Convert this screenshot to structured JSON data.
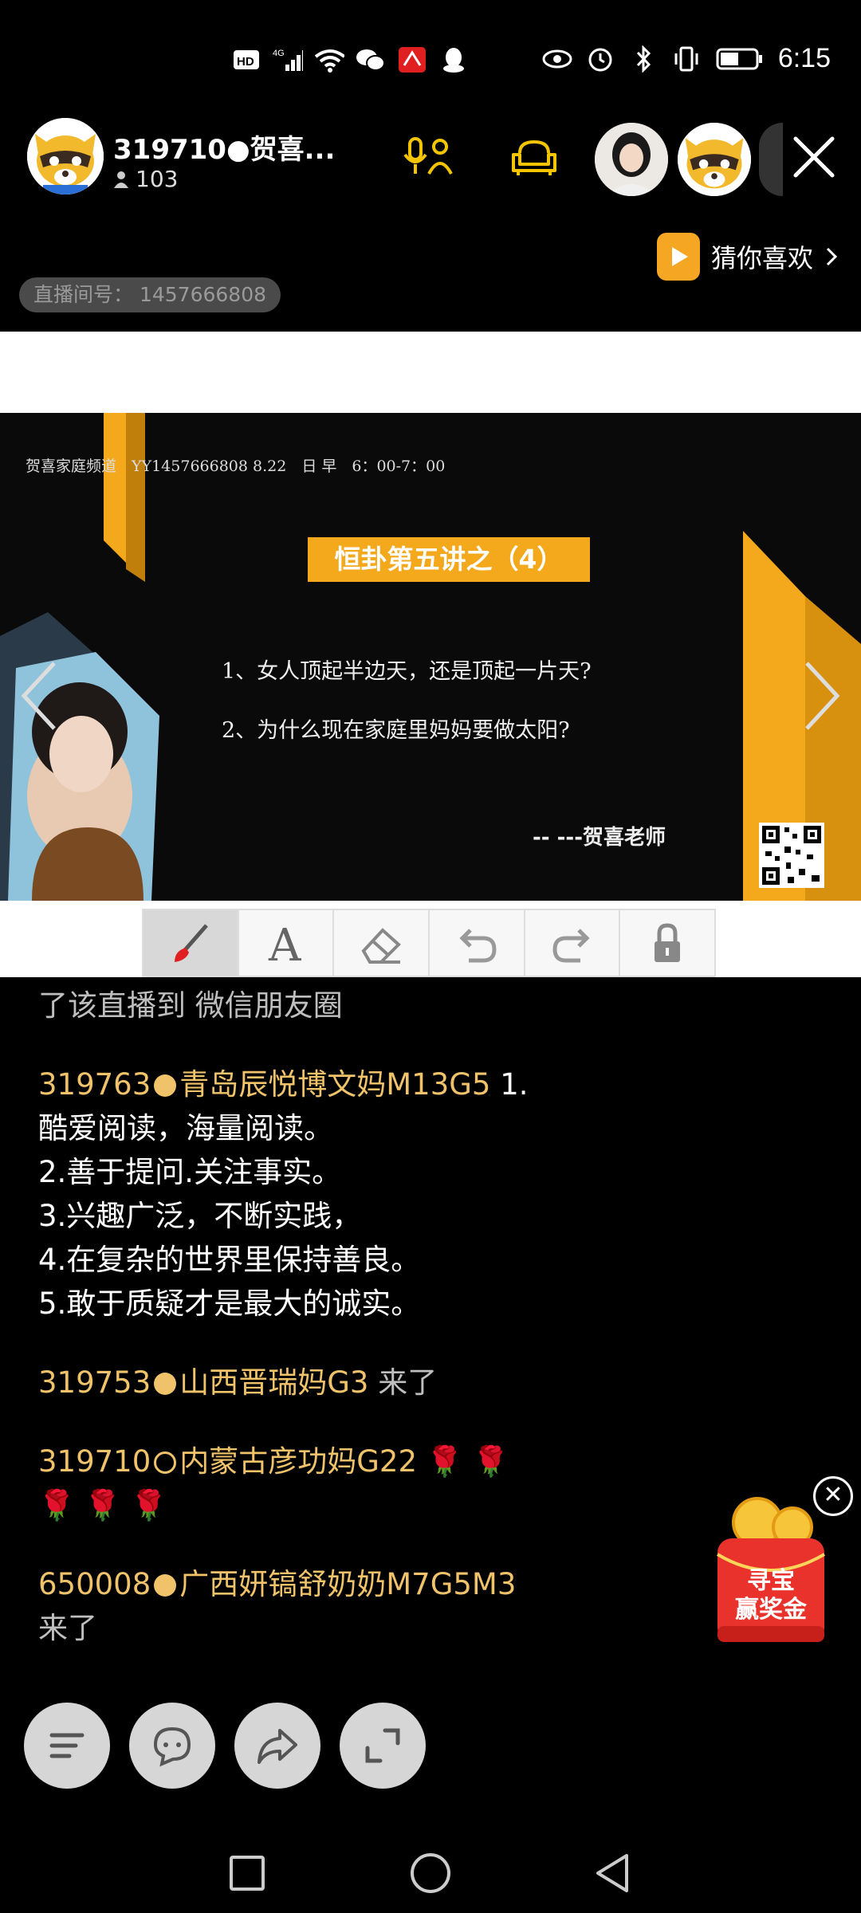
{
  "status_bar": {
    "time": "6:15",
    "icons": [
      "hd-icon",
      "4g-signal-icon",
      "wifi-icon",
      "wechat-icon",
      "app-notification-icon",
      "qq-icon",
      "eye-icon",
      "alarm-icon",
      "bluetooth-icon",
      "vibrate-icon",
      "battery-icon"
    ]
  },
  "header": {
    "host_name": "319710●贺喜...",
    "viewer_count": "103",
    "guess_label": "猜你喜欢",
    "room_id_label": "直播间号： 1457666808"
  },
  "slide": {
    "info_line": "贺喜家庭频道　YY1457666808 8.22　日 早　6：00-7：00",
    "title": "恒卦第五讲之（4）",
    "q1": "1、女人顶起半边天，还是顶起一片天?",
    "q2": "2、为什么现在家庭里妈妈要做太阳?",
    "teacher": "-- ---贺喜老师"
  },
  "tools": [
    "brush-tool",
    "text-tool",
    "eraser-tool",
    "undo-tool",
    "redo-tool",
    "lock-tool"
  ],
  "chat": {
    "m0_text": "了该直播到 微信朋友圈",
    "m1_user": "319763",
    "m1_name": "青岛辰悦博文妈M13G5",
    "m1_line1": " 1.",
    "m1_line2": "酷爱阅读，海量阅读。",
    "m1_line3": "2.善于提问.关注事实。",
    "m1_line4": "3.兴趣广泛，不断实践，",
    "m1_line5": "4.在复杂的世界里保持善良。",
    "m1_line6": "5.敢于质疑才是最大的诚实。",
    "m2_user": "319753",
    "m2_name": "山西晋瑞妈G3",
    "m2_text": " 来了",
    "m3_user": "319710",
    "m3_name": "内蒙古彦功妈G22",
    "m3_roses1": " 🌹 🌹",
    "m3_roses2": "🌹 🌹 🌹",
    "m4_user": "650008",
    "m4_name": "广西妍镐舒奶奶M7G5M3",
    "m4_text": "来了"
  },
  "treasure": {
    "line1": "寻宝",
    "line2": "赢奖金",
    "close": "✕"
  },
  "colors": {
    "accent": "#f4a81c",
    "username": "#f0c36b",
    "icon_yellow": "#f5c400"
  }
}
